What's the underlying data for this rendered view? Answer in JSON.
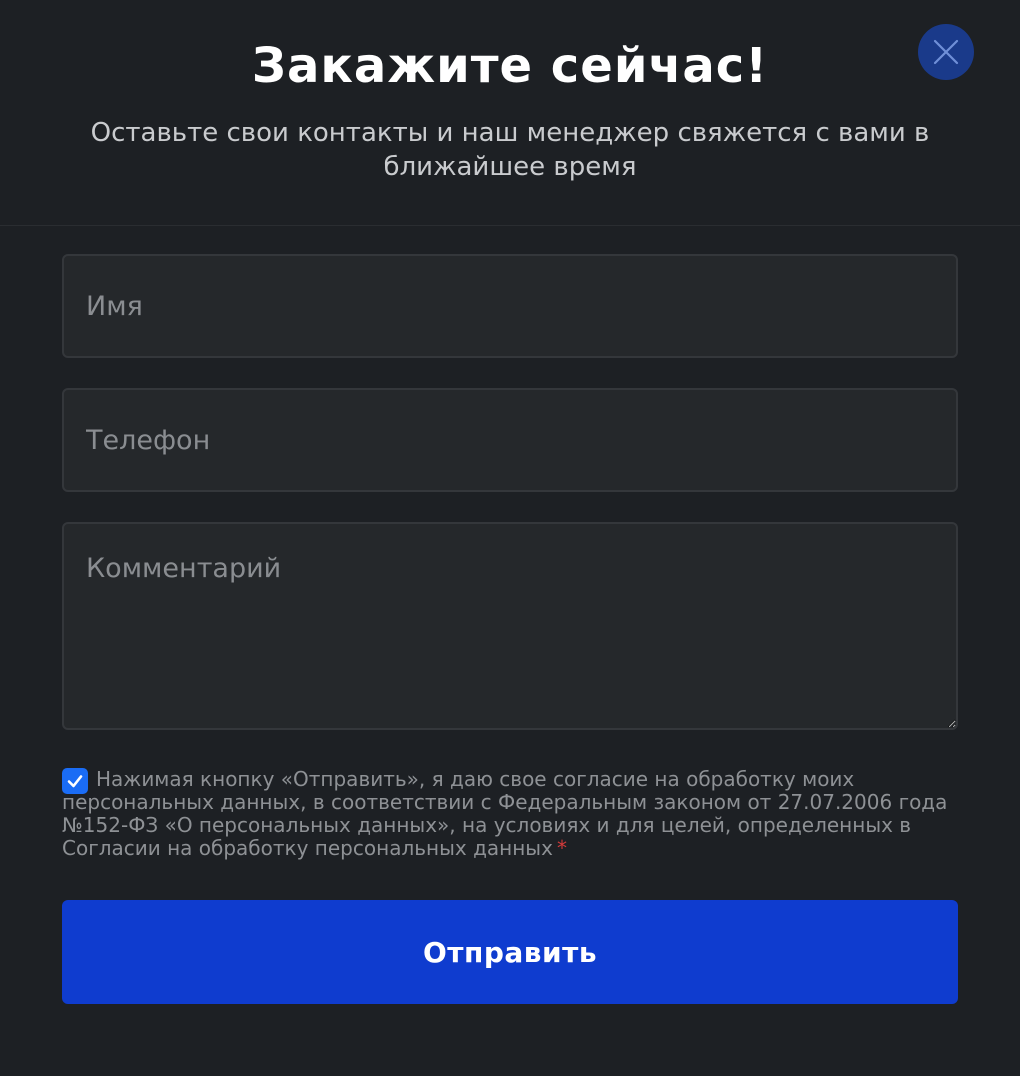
{
  "header": {
    "title": "Закажите сейчас!",
    "subtitle": "Оставьте свои контакты и наш менеджер свяжется с вами в ближайшее время"
  },
  "form": {
    "name_placeholder": "Имя",
    "phone_placeholder": "Телефон",
    "comment_placeholder": "Комментарий",
    "consent_text": "Нажимая кнопку «Отправить», я даю свое согласие на обработку моих персональных данных, в соответствии с Федеральным законом от 27.07.2006 года №152-ФЗ «О персональных данных», на условиях и для целей, определенных в Согласии на обработку персональных данных",
    "required_mark": "*",
    "consent_checked": true,
    "submit_label": "Отправить"
  },
  "icons": {
    "close": "close-icon",
    "check": "check-icon"
  },
  "colors": {
    "background": "#1d2024",
    "field_bg": "#25282b",
    "accent": "#0f3ccf",
    "close_bg": "#1a3a8a",
    "checkbox": "#1a6cf5",
    "required": "#d33a3a"
  }
}
